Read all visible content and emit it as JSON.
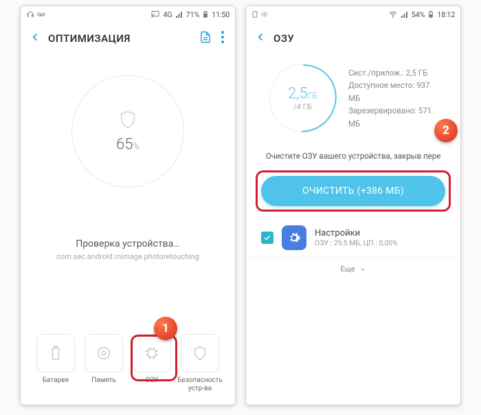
{
  "left": {
    "status": {
      "battery": "71%",
      "time": "11:50",
      "net": "4G"
    },
    "header": {
      "title": "ОПТИМИЗАЦИЯ"
    },
    "percent": "65",
    "percent_unit": "%",
    "scan_text": "Проверка устройства…",
    "scan_sub": "com.sec.android.mimage.photoretouching",
    "cards": [
      {
        "name": "battery-card",
        "icon": "battery",
        "label": "Батарея"
      },
      {
        "name": "storage-card",
        "icon": "target",
        "label": "Память"
      },
      {
        "name": "ram-card",
        "icon": "chip",
        "label": "ОЗУ"
      },
      {
        "name": "security-card",
        "icon": "shield",
        "label": "Безопасность\nустр-ва"
      }
    ],
    "badge": "1"
  },
  "right": {
    "status": {
      "battery": "54%",
      "time": "18:12"
    },
    "header": {
      "title": "ОЗУ"
    },
    "ram_used_value": "2,5",
    "ram_used_unit": "ГБ",
    "ram_total": "/4 ГБ",
    "lines": {
      "system": "Сист./прилож.: 2,5 ГБ",
      "free": "Доступное место: 937 МБ",
      "reserved": "Зарезервировано: 571 МБ"
    },
    "hint": "Очистите ОЗУ вашего устройства, закрыв пере",
    "clean_label": "ОЧИСТИТЬ (+386 МБ)",
    "app": {
      "name": "Настройки",
      "sub": "ОЗУ : 29,5 МБ, ЦП : 0,00%"
    },
    "more": "Еще",
    "badge": "2"
  }
}
